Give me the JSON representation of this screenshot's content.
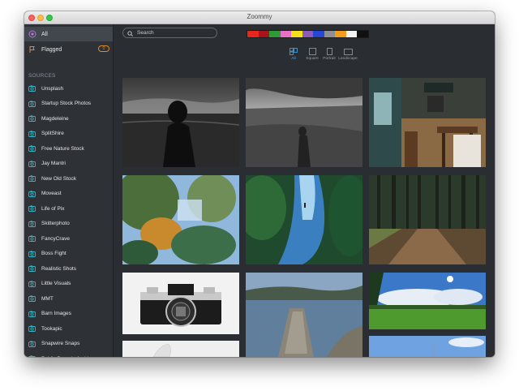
{
  "window": {
    "title": "Zoommy"
  },
  "sidebar": {
    "all_label": "All",
    "flagged_label": "Flagged",
    "flagged_count": "0",
    "sources_heading": "SOURCES",
    "sources": [
      "Unsplash",
      "Startup Stock Photos",
      "Magdeleine",
      "SplitShire",
      "Free Nature Stock",
      "Jay Mantri",
      "New Old Stock",
      "Moveast",
      "Life of Pix",
      "Skitterphoto",
      "FancyCrave",
      "Boss Fight",
      "Realistic Shots",
      "Little Visuals",
      "MMT",
      "Barn Images",
      "Tookapic",
      "Snapwire Snaps",
      "Public Domain Archive"
    ]
  },
  "toolbar": {
    "search_placeholder": "Search",
    "palette_colors": [
      "#e8261f",
      "#a8141b",
      "#2f9b36",
      "#e96fc7",
      "#f3e21b",
      "#8c5bb9",
      "#2547d4",
      "#8e8f92",
      "#f19c1d",
      "#f2f2f2",
      "#101010"
    ]
  },
  "view_modes": [
    {
      "label": "All",
      "icon": "grid-icon",
      "active": true
    },
    {
      "label": "Square",
      "icon": "square-icon",
      "active": false
    },
    {
      "label": "Portrait",
      "icon": "portrait-icon",
      "active": false
    },
    {
      "label": "Landscape",
      "icon": "landscape-icon",
      "active": false
    }
  ],
  "colors": {
    "accent": "#4aa8e8",
    "badge": "#e08c2c",
    "sidebar_bg": "#2e3136",
    "main_bg": "#2a2d31"
  }
}
